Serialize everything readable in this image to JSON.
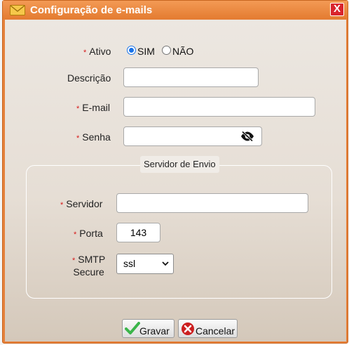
{
  "window": {
    "title": "Configuração de e-mails",
    "close_label": "X"
  },
  "form": {
    "required_mark": "*",
    "ativo": {
      "label": "Ativo",
      "options": [
        {
          "label": "SIM",
          "checked": true
        },
        {
          "label": "NÃO",
          "checked": false
        }
      ]
    },
    "descricao": {
      "label": "Descrição",
      "value": ""
    },
    "email": {
      "label": "E-mail",
      "value": ""
    },
    "senha": {
      "label": "Senha",
      "value": ""
    }
  },
  "servidor_envio": {
    "legend": "Servidor de Envio",
    "servidor": {
      "label": "Servidor",
      "value": ""
    },
    "porta": {
      "label": "Porta",
      "value": "143"
    },
    "smtp_secure": {
      "label_line1": "SMTP",
      "label_line2": "Secure",
      "selected": "ssl"
    }
  },
  "actions": {
    "save_label": "Gravar",
    "cancel_label": "Cancelar"
  },
  "colors": {
    "title_bar": "#e5813b",
    "required": "#d71a1a",
    "save_icon": "#3bb54a",
    "cancel_icon": "#cc1f1f",
    "radio_accent": "#1a73e8"
  }
}
